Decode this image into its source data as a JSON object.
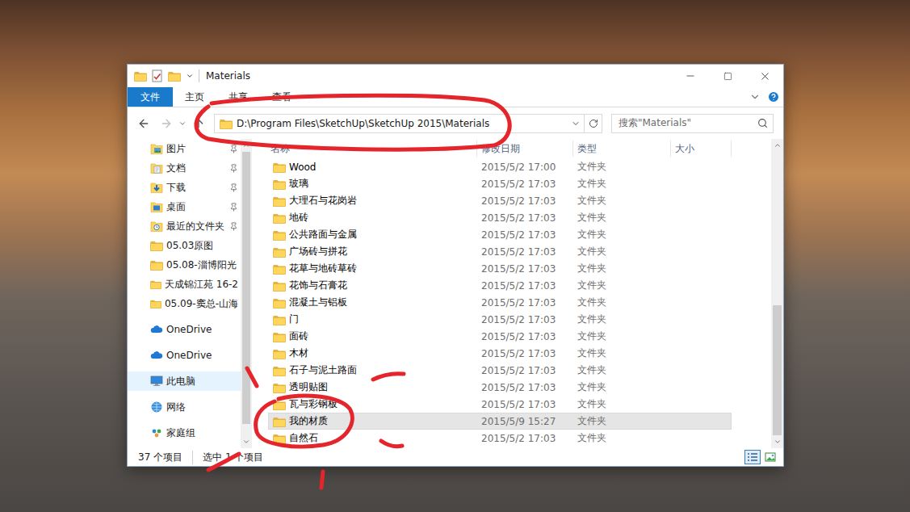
{
  "window": {
    "title": "Materials"
  },
  "ribbon": {
    "file_button": "文件",
    "tabs": [
      {
        "label": "主页",
        "selected": false
      },
      {
        "label": "共享",
        "selected": false
      },
      {
        "label": "查看",
        "selected": false
      }
    ]
  },
  "address": {
    "path": "D:\\Program Files\\SketchUp\\SketchUp 2015\\Materials",
    "forward_enabled": false
  },
  "search": {
    "placeholder": "搜索\"Materials\""
  },
  "sidebar": {
    "sections": [
      {
        "items": [
          {
            "label": "图片",
            "kind": "pictures",
            "pinned": true,
            "selected": false
          },
          {
            "label": "文档",
            "kind": "documents",
            "pinned": true,
            "selected": false
          },
          {
            "label": "下载",
            "kind": "downloads",
            "pinned": true,
            "selected": false
          },
          {
            "label": "桌面",
            "kind": "desktop",
            "pinned": true,
            "selected": false
          },
          {
            "label": "最近的文件夹",
            "kind": "recent",
            "pinned": true,
            "selected": false
          },
          {
            "label": "05.03原图",
            "kind": "folder",
            "pinned": false,
            "selected": false
          },
          {
            "label": "05.08-淄博阳光",
            "kind": "folder",
            "pinned": false,
            "selected": false
          },
          {
            "label": "天成锦江苑 16-2",
            "kind": "folder",
            "pinned": false,
            "selected": false
          },
          {
            "label": "05.09-窦总-山海",
            "kind": "folder",
            "pinned": false,
            "selected": false
          }
        ]
      },
      {
        "items": [
          {
            "label": "OneDrive",
            "kind": "cloud",
            "pinned": false,
            "selected": false
          }
        ]
      },
      {
        "items": [
          {
            "label": "OneDrive",
            "kind": "cloud",
            "pinned": false,
            "selected": false
          }
        ]
      },
      {
        "items": [
          {
            "label": "此电脑",
            "kind": "pc",
            "pinned": false,
            "selected": true
          }
        ]
      },
      {
        "items": [
          {
            "label": "网络",
            "kind": "network",
            "pinned": false,
            "selected": false
          }
        ]
      },
      {
        "items": [
          {
            "label": "家庭组",
            "kind": "homegroup",
            "pinned": false,
            "selected": false
          }
        ]
      }
    ],
    "scrollbar": {
      "start": 0.0,
      "size": 0.96
    }
  },
  "list": {
    "columns": [
      "名称",
      "修改日期",
      "类型",
      "大小"
    ],
    "rows": [
      {
        "name": "Wood",
        "modified": "2015/5/2 17:00",
        "type": "文件夹",
        "size": "",
        "selected": false
      },
      {
        "name": "玻璃",
        "modified": "2015/5/2 17:03",
        "type": "文件夹",
        "size": "",
        "selected": false
      },
      {
        "name": "大理石与花岗岩",
        "modified": "2015/5/2 17:03",
        "type": "文件夹",
        "size": "",
        "selected": false
      },
      {
        "name": "地砖",
        "modified": "2015/5/2 17:03",
        "type": "文件夹",
        "size": "",
        "selected": false
      },
      {
        "name": "公共路面与金属",
        "modified": "2015/5/2 17:03",
        "type": "文件夹",
        "size": "",
        "selected": false
      },
      {
        "name": "广场砖与拼花",
        "modified": "2015/5/2 17:03",
        "type": "文件夹",
        "size": "",
        "selected": false
      },
      {
        "name": "花草与地砖草砖",
        "modified": "2015/5/2 17:03",
        "type": "文件夹",
        "size": "",
        "selected": false
      },
      {
        "name": "花饰与石膏花",
        "modified": "2015/5/2 17:03",
        "type": "文件夹",
        "size": "",
        "selected": false
      },
      {
        "name": "混凝土与铝板",
        "modified": "2015/5/2 17:03",
        "type": "文件夹",
        "size": "",
        "selected": false
      },
      {
        "name": "门",
        "modified": "2015/5/2 17:03",
        "type": "文件夹",
        "size": "",
        "selected": false
      },
      {
        "name": "面砖",
        "modified": "2015/5/2 17:03",
        "type": "文件夹",
        "size": "",
        "selected": false
      },
      {
        "name": "木材",
        "modified": "2015/5/2 17:03",
        "type": "文件夹",
        "size": "",
        "selected": false
      },
      {
        "name": "石子与泥土路面",
        "modified": "2015/5/2 17:03",
        "type": "文件夹",
        "size": "",
        "selected": false
      },
      {
        "name": "透明贴图",
        "modified": "2015/5/2 17:03",
        "type": "文件夹",
        "size": "",
        "selected": false
      },
      {
        "name": "瓦与彩钢板",
        "modified": "2015/5/2 17:03",
        "type": "文件夹",
        "size": "",
        "selected": false
      },
      {
        "name": "我的材质",
        "modified": "2015/5/9 15:27",
        "type": "文件夹",
        "size": "",
        "selected": true
      },
      {
        "name": "自然石",
        "modified": "2015/5/2 17:03",
        "type": "文件夹",
        "size": "",
        "selected": false
      }
    ],
    "scrollbar": {
      "start": 0.54,
      "size": 0.46
    }
  },
  "status_bar": {
    "items": [
      "37 个项目",
      "选中 1 个项目"
    ],
    "views": [
      {
        "kind": "details",
        "selected": true
      },
      {
        "kind": "icons",
        "selected": false
      }
    ]
  }
}
